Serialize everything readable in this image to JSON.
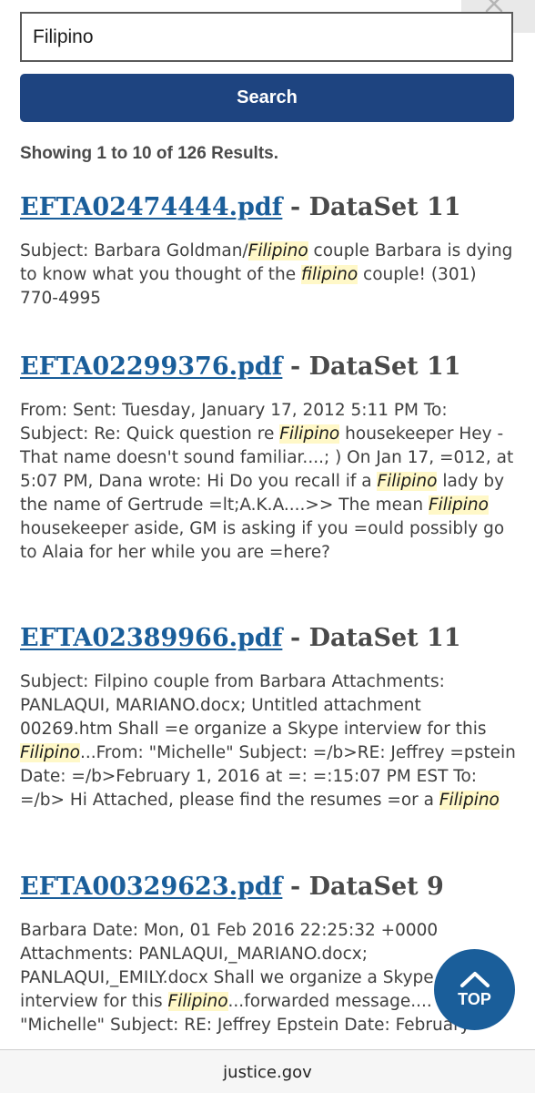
{
  "search": {
    "query": "Filipino",
    "button_label": "Search"
  },
  "results_count": "Showing 1 to 10 of 126 Results.",
  "results": [
    {
      "filename": "EFTA02474444.pdf",
      "dataset": "- DataSet 11",
      "snippet": [
        {
          "t": "Subject: Barbara Goldman/",
          "h": false
        },
        {
          "t": "Filipino",
          "h": true
        },
        {
          "t": " couple Barbara is dying to know what you thought of the ",
          "h": false
        },
        {
          "t": "filipino",
          "h": true
        },
        {
          "t": " couple! (301) 770-4995",
          "h": false
        }
      ]
    },
    {
      "filename": "EFTA02299376.pdf",
      "dataset": "- DataSet 11",
      "snippet": [
        {
          "t": "From: Sent: Tuesday, January 17, 2012 5:11 PM To: Subject: Re: Quick question re ",
          "h": false
        },
        {
          "t": "Filipino",
          "h": true
        },
        {
          "t": " housekeeper Hey - That name doesn't sound familiar....; ) On Jan 17, =012, at 5:07 PM, Dana wrote: Hi Do you recall if a ",
          "h": false
        },
        {
          "t": "Filipino",
          "h": true
        },
        {
          "t": " lady by the name of Gertrude =lt;A.K.A....>> The mean ",
          "h": false
        },
        {
          "t": "Filipino",
          "h": true
        },
        {
          "t": " housekeeper aside, GM is asking if you =ould possibly go to Alaia for her while you are =here?",
          "h": false
        }
      ]
    },
    {
      "filename": "EFTA02389966.pdf",
      "dataset": "- DataSet 11",
      "snippet": [
        {
          "t": "Subject: Filpino couple from Barbara Attachments: PANLAQUI, MARIANO.docx; Untitled attachment 00269.htm Shall =e organize a Skype interview for this ",
          "h": false
        },
        {
          "t": "Filipino",
          "h": true
        },
        {
          "t": "...From: \"Michelle\" Subject: =/b>RE: Jeffrey =pstein Date: =/b>February 1, 2016 at =: =:15:07 PM EST To: =/b> Hi Attached, please find the resumes =or a ",
          "h": false
        },
        {
          "t": "Filipino",
          "h": true
        }
      ]
    },
    {
      "filename": "EFTA00329623.pdf",
      "dataset": "- DataSet 9",
      "snippet": [
        {
          "t": "Barbara Date: Mon, 01 Feb 2016 22:25:32 +0000 Attachments: PANLAQUI,_MARIANO.docx; PANLAQUI,_EMILY.docx Shall we organize a Skype interview for this ",
          "h": false
        },
        {
          "t": "Filipino",
          "h": true
        },
        {
          "t": "...forwarded message.... \"Michelle\" Subject: RE: Jeffrey Epstein Date: February",
          "h": false
        }
      ]
    }
  ],
  "top_button_label": "TOP",
  "footer_domain": "justice.gov"
}
